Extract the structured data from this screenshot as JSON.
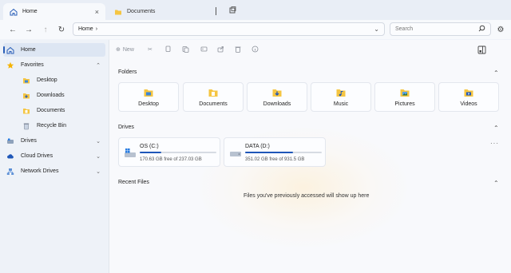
{
  "tabs": [
    {
      "label": "Home",
      "icon": "home-icon",
      "close": "×",
      "active": true
    },
    {
      "label": "Documents",
      "icon": "folder-icon",
      "active": false
    }
  ],
  "address": {
    "path": "Home",
    "separator": "›",
    "dropdown": "⌄"
  },
  "search": {
    "placeholder": "Search"
  },
  "sidebar": {
    "items": [
      {
        "label": "Home",
        "icon": "home-icon",
        "selected": true
      },
      {
        "label": "Favorites",
        "icon": "star-icon",
        "chevron": "⌃"
      },
      {
        "label": "Desktop",
        "icon": "desktop-folder-icon"
      },
      {
        "label": "Downloads",
        "icon": "downloads-folder-icon"
      },
      {
        "label": "Documents",
        "icon": "documents-folder-icon"
      },
      {
        "label": "Recycle Bin",
        "icon": "recycle-bin-icon"
      },
      {
        "label": "Drives",
        "icon": "drive-icon",
        "chevron": "⌄"
      },
      {
        "label": "Cloud Drives",
        "icon": "cloud-icon",
        "chevron": "⌄"
      },
      {
        "label": "Network Drives",
        "icon": "network-icon",
        "chevron": "⌄"
      }
    ]
  },
  "toolbar": {
    "new_label": "New"
  },
  "sections": {
    "folders": "Folders",
    "drives": "Drives",
    "recent": "Recent Files",
    "collapse": "⌃"
  },
  "folders": [
    {
      "label": "Desktop",
      "icon": "desktop-folder-icon"
    },
    {
      "label": "Documents",
      "icon": "documents-folder-icon"
    },
    {
      "label": "Downloads",
      "icon": "downloads-folder-icon"
    },
    {
      "label": "Music",
      "icon": "music-folder-icon"
    },
    {
      "label": "Pictures",
      "icon": "pictures-folder-icon"
    },
    {
      "label": "Videos",
      "icon": "videos-folder-icon"
    }
  ],
  "drives": [
    {
      "name": "OS (C:)",
      "free": "170.63 GB free of 237.03 GB",
      "used_fraction": 0.28
    },
    {
      "name": "DATA (D:)",
      "free": "351.02 GB free of 931.5 GB",
      "used_fraction": 0.62
    }
  ],
  "recent_empty_message": "Files you've previously accessed will show up here",
  "more_label": "···",
  "colors": {
    "accent": "#1f57b8",
    "folder": "#f5c542"
  }
}
